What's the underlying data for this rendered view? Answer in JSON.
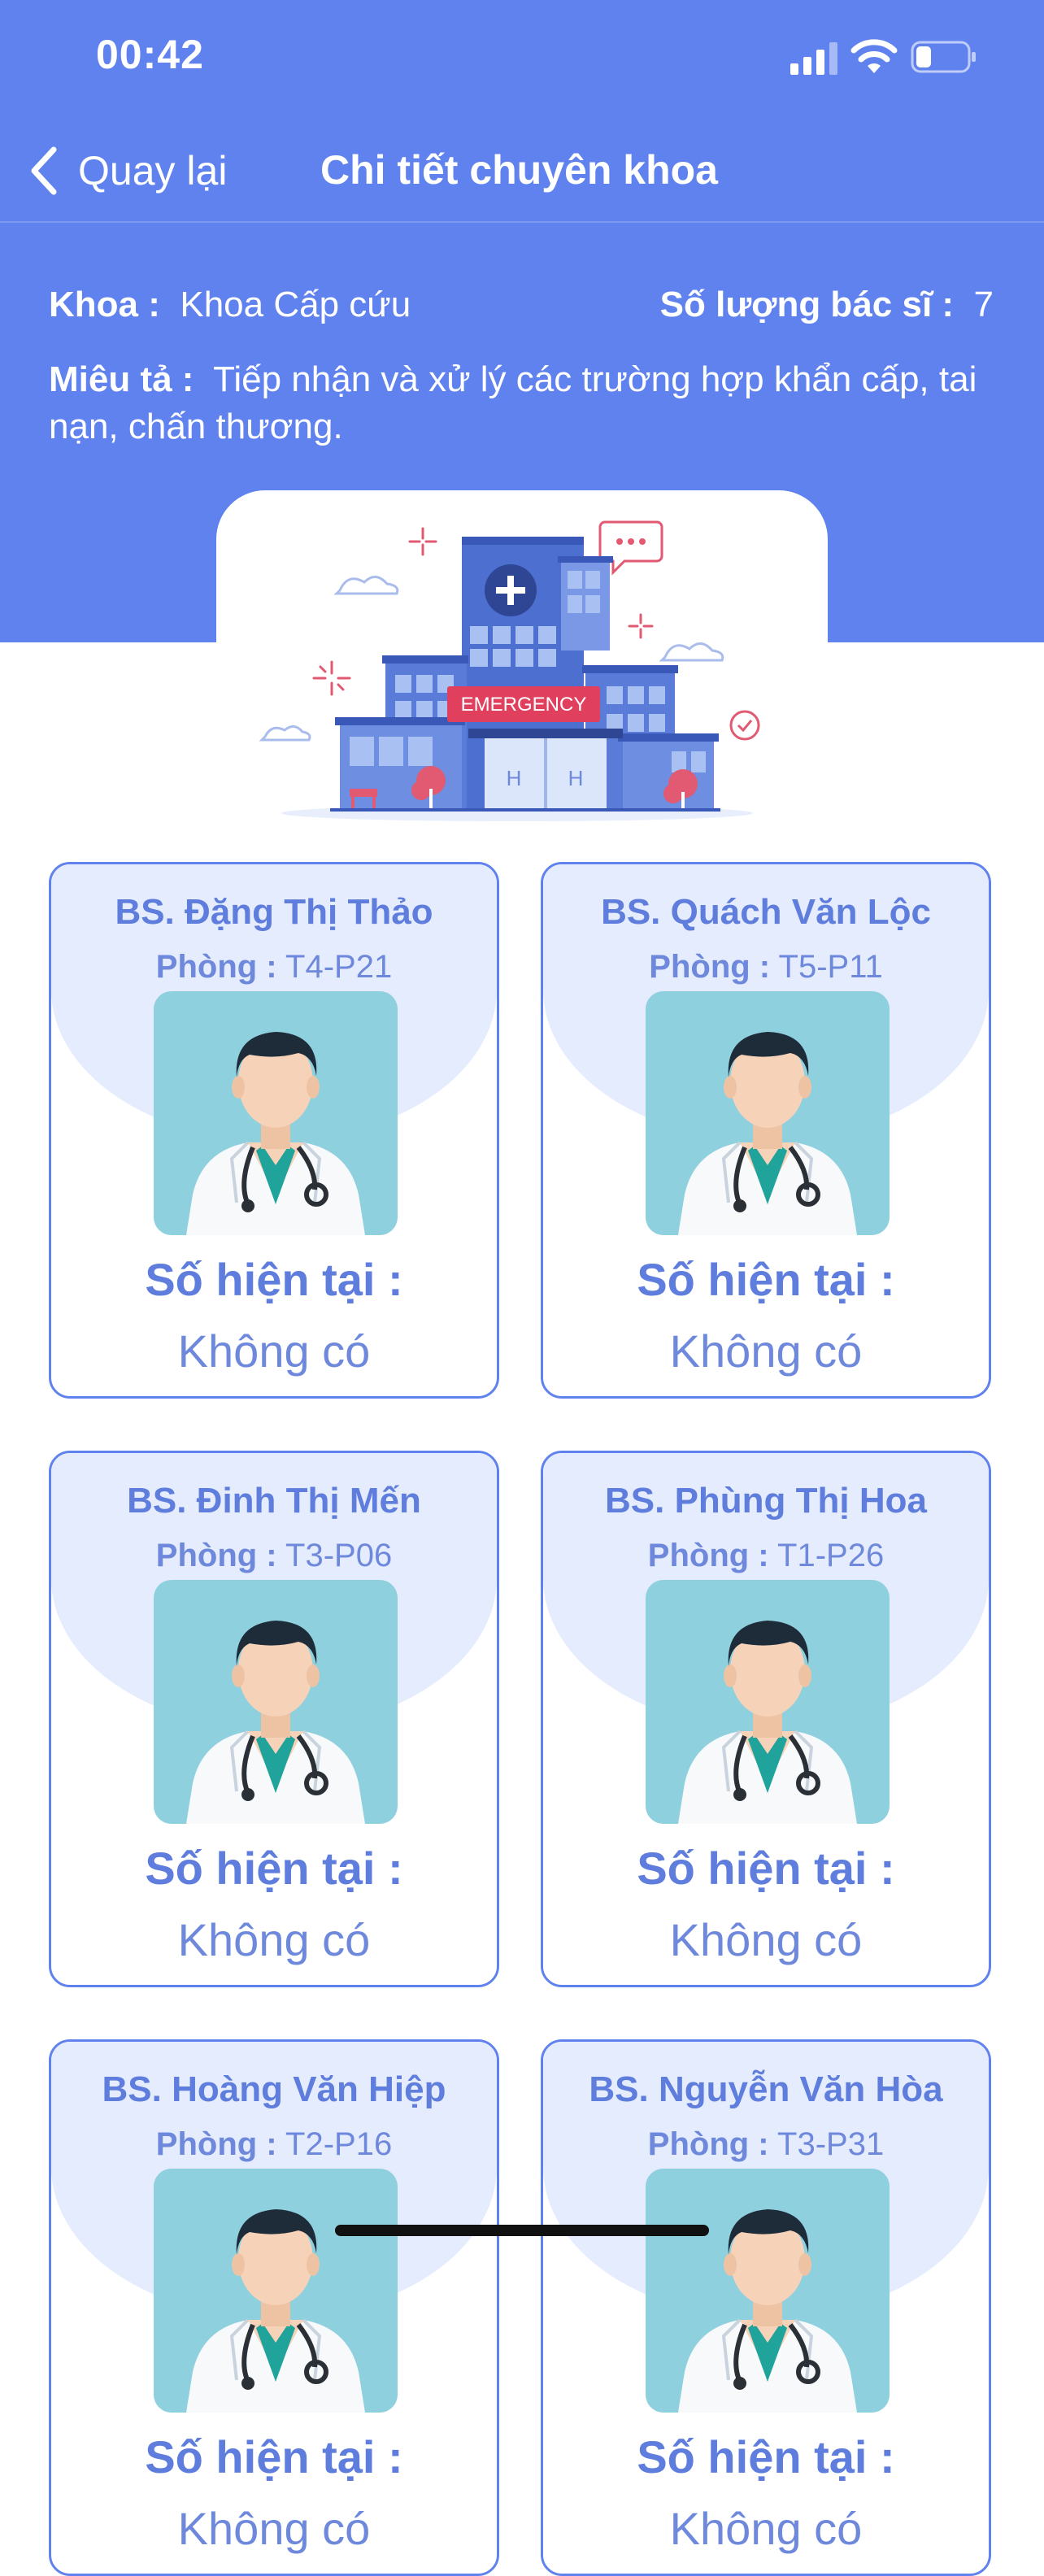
{
  "status_bar": {
    "time": "00:42"
  },
  "nav": {
    "back_label": "Quay lại",
    "title": "Chi tiết chuyên khoa"
  },
  "department": {
    "name_label": "Khoa :",
    "name": "Khoa Cấp cứu",
    "doctor_count_label": "Số lượng bác sĩ :",
    "doctor_count": "7",
    "description_label": "Miêu tả :",
    "description": "Tiếp nhận và xử lý các trường hợp khẩn cấp, tai nạn, chấn thương."
  },
  "banner": {
    "sign_text": "EMERGENCY"
  },
  "doctors": [
    {
      "name": "BS. Đặng Thị Thảo",
      "room_label": "Phòng :",
      "room": "T4-P21",
      "current_label": "Số hiện tại :",
      "current": "Không có"
    },
    {
      "name": "BS. Quách Văn Lộc",
      "room_label": "Phòng :",
      "room": "T5-P11",
      "current_label": "Số hiện tại :",
      "current": "Không có"
    },
    {
      "name": "BS. Đinh Thị Mến",
      "room_label": "Phòng :",
      "room": "T3-P06",
      "current_label": "Số hiện tại :",
      "current": "Không có"
    },
    {
      "name": "BS. Phùng Thị Hoa",
      "room_label": "Phòng :",
      "room": "T1-P26",
      "current_label": "Số hiện tại :",
      "current": "Không có"
    },
    {
      "name": "BS. Hoàng Văn Hiệp",
      "room_label": "Phòng :",
      "room": "T2-P16",
      "current_label": "Số hiện tại :",
      "current": "Không có"
    },
    {
      "name": "BS. Nguyễn Văn Hòa",
      "room_label": "Phòng :",
      "room": "T3-P31",
      "current_label": "Số hiện tại :",
      "current": "Không có"
    }
  ],
  "colors": {
    "primary": "#6082EE",
    "card_tint": "#E5ECFD",
    "avatar_bg": "#8FD0DF"
  }
}
